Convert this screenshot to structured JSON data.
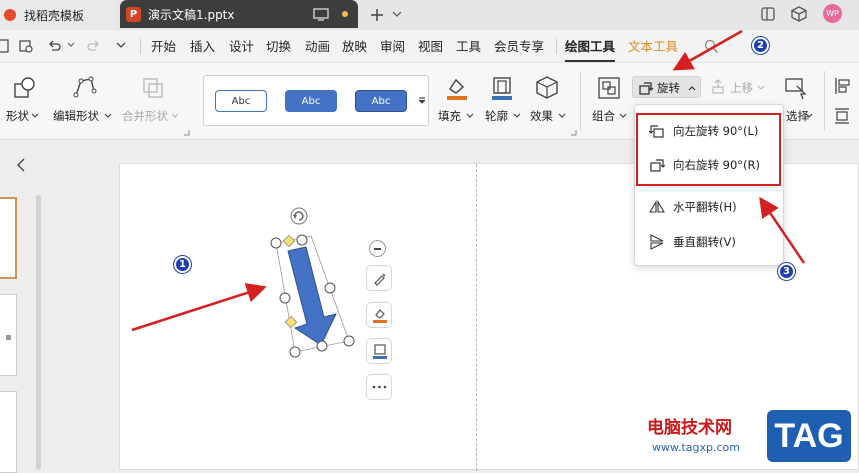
{
  "titlebar": {
    "home_tab": "找稻壳模板",
    "doc_tab": "演示文稿1.pptx",
    "ppt_logo": "P",
    "avatar": "WP"
  },
  "menu": {
    "items": [
      "开始",
      "插入",
      "设计",
      "切换",
      "动画",
      "放映",
      "审阅",
      "视图",
      "工具",
      "会员专享"
    ],
    "drawing_tools": "绘图工具",
    "text_tools": "文本工具"
  },
  "ribbon": {
    "shape": "形状",
    "edit_shape": "编辑形状",
    "merge_shape": "合并形状",
    "style_samples": [
      "Abc",
      "Abc",
      "Abc"
    ],
    "fill": "填充",
    "outline": "轮廓",
    "effect": "效果",
    "group": "组合",
    "rotate": "旋转",
    "move_up": "上移",
    "select": "选择"
  },
  "dropdown": {
    "items": [
      "向左旋转 90°(L)",
      "向右旋转 90°(R)",
      "水平翻转(H)",
      "垂直翻转(V)"
    ]
  },
  "annotations": {
    "badge1": "1",
    "badge2": "2",
    "badge3": "3"
  },
  "watermark": {
    "site_name": "电脑技术网",
    "url": "www.tagxp.com",
    "tag": "TAG"
  },
  "colors": {
    "accent_red": "#d42020",
    "shape_blue": "#4472c4",
    "badge_blue": "#1e3fb0",
    "text_tools_orange": "#e08a1e"
  }
}
